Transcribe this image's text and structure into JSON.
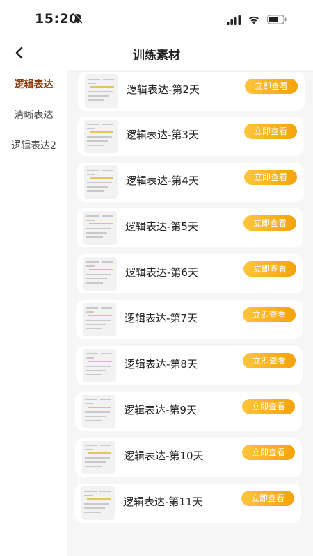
{
  "status_bar": {
    "time": "15:20"
  },
  "header": {
    "title": "训练素材"
  },
  "sidebar": {
    "items": [
      {
        "label": "逻辑表达",
        "active": true
      },
      {
        "label": "清晰表达",
        "active": false
      },
      {
        "label": "逻辑表达2",
        "active": false
      }
    ]
  },
  "list": {
    "button_label": "立即查看",
    "items": [
      {
        "title": "逻辑表达-第2天"
      },
      {
        "title": "逻辑表达-第3天"
      },
      {
        "title": "逻辑表达-第4天"
      },
      {
        "title": "逻辑表达-第5天"
      },
      {
        "title": "逻辑表达-第6天"
      },
      {
        "title": "逻辑表达-第7天"
      },
      {
        "title": "逻辑表达-第8天"
      },
      {
        "title": "逻辑表达-第9天"
      },
      {
        "title": "逻辑表达-第10天"
      },
      {
        "title": "逻辑表达-第11天"
      }
    ]
  },
  "colors": {
    "accent_start": "#ffc53d",
    "accent_end": "#f5a20a",
    "sidebar_active": "#8a3d10",
    "list_background": "#f6f6f6"
  },
  "icons": [
    "bell-muted-icon",
    "signal-icon",
    "wifi-icon",
    "battery-icon",
    "back-arrow-icon"
  ]
}
